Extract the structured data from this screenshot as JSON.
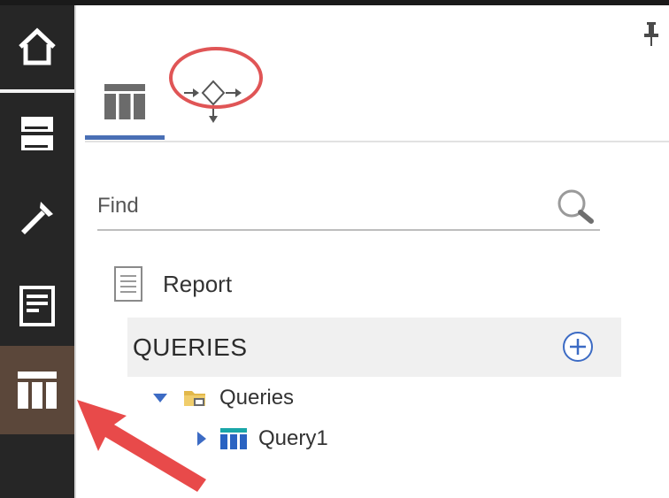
{
  "search": {
    "placeholder": "Find"
  },
  "tree": {
    "report_label": "Report",
    "section_heading": "QUERIES",
    "folder_label": "Queries",
    "query_label": "Query1"
  },
  "colors": {
    "sidebar": "#262626",
    "sidebar_active": "#5b473a",
    "tab_indicator": "#4a6fb5",
    "highlight": "#e05556",
    "add_button": "#3c6bc4"
  },
  "icons": {
    "sidebar": [
      "home-icon",
      "server-icon",
      "hammer-icon",
      "report-icon",
      "data-table-icon"
    ],
    "tabs": [
      "data-table-icon",
      "flow-diagram-icon"
    ],
    "panel": [
      "pin-icon",
      "search-icon",
      "add-circle-icon",
      "document-icon",
      "folder-icon",
      "query-table-icon"
    ]
  }
}
